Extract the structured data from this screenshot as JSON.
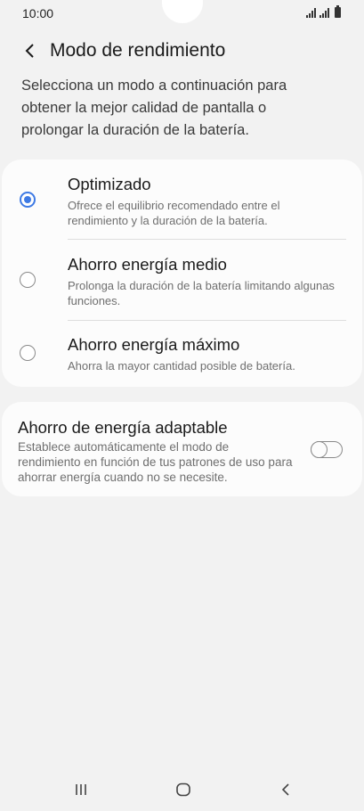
{
  "status_bar": {
    "time": "10:00"
  },
  "header": {
    "title": "Modo de rendimiento"
  },
  "intro": "Selecciona un modo a continuación para obtener la mejor calidad de pantalla o prolongar la duración de la batería.",
  "modes": [
    {
      "title": "Optimizado",
      "description": "Ofrece el equilibrio recomendado entre el rendimiento y la duración de la batería.",
      "selected": true
    },
    {
      "title": "Ahorro energía medio",
      "description": "Prolonga la duración de la batería limitando algunas funciones.",
      "selected": false
    },
    {
      "title": "Ahorro energía máximo",
      "description": "Ahorra la mayor cantidad posible de batería.",
      "selected": false
    }
  ],
  "adaptive": {
    "title": "Ahorro de energía adaptable",
    "description": "Establece automáticamente el modo de rendimiento en función de tus patrones de uso para ahorrar energía cuando no se necesite.",
    "enabled": false
  },
  "colors": {
    "accent": "#3e7ae4",
    "background": "#f2f2f2",
    "card": "#fcfcfc"
  },
  "icons": {
    "back": "chevron-left-icon",
    "recents": "recent-apps-icon",
    "home": "home-icon",
    "nav_back": "back-icon"
  }
}
